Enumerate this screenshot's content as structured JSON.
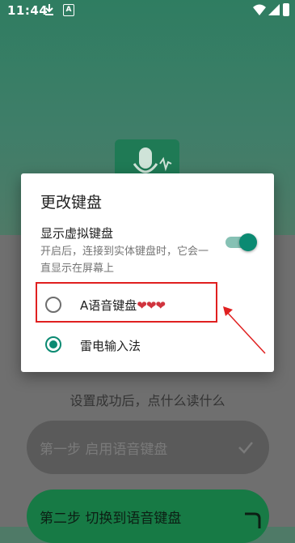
{
  "status_bar": {
    "time": "11:44",
    "icons": [
      "download-icon",
      "a-notification-icon",
      "wifi-icon",
      "signal-icon",
      "battery-icon"
    ]
  },
  "background": {
    "hint_text": "设置成功后，点什么读什么",
    "step1_label": "第一步 启用语音键盘",
    "step2_label": "第二步 切换到语音键盘"
  },
  "dialog": {
    "title": "更改键盘",
    "toggle_label": "显示虚拟键盘",
    "toggle_description": "开启后，连接到实体键盘时，它会一直显示在屏幕上",
    "toggle_on": true,
    "options": [
      {
        "label": "A语音键盘",
        "suffix": "❤❤❤",
        "selected": false
      },
      {
        "label": "雷电输入法",
        "selected": true
      }
    ]
  },
  "colors": {
    "accent": "#0b8a72",
    "highlight": "#e02020",
    "step2_bg": "#177a45"
  }
}
